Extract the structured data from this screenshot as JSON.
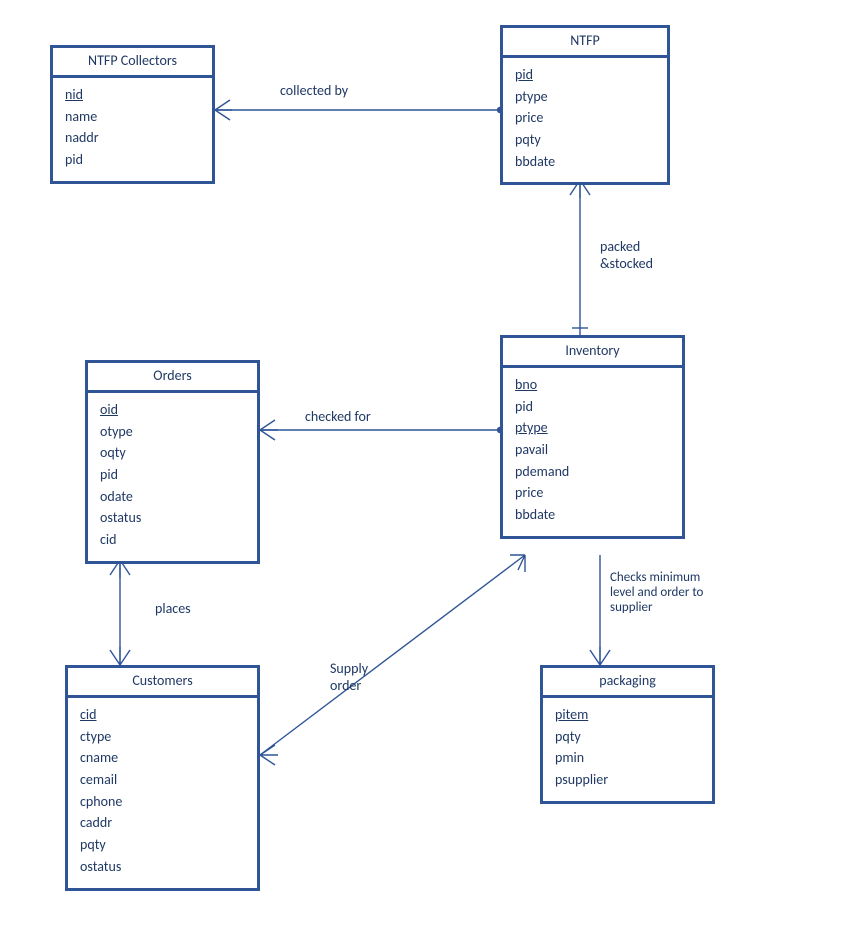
{
  "entities": {
    "collectors": {
      "title": "NTFP Collectors",
      "attrs": [
        "nid",
        "name",
        "naddr",
        "pid"
      ],
      "pk": [
        "nid"
      ]
    },
    "ntfp": {
      "title": "NTFP",
      "attrs": [
        "pid",
        "ptype",
        "price",
        "pqty",
        "bbdate"
      ],
      "pk": [
        "pid"
      ]
    },
    "orders": {
      "title": "Orders",
      "attrs": [
        "oid",
        "otype",
        "oqty",
        "pid",
        "odate",
        "ostatus",
        "cid"
      ],
      "pk": [
        "oid"
      ]
    },
    "inventory": {
      "title": "Inventory",
      "attrs": [
        "bno",
        "pid",
        "ptype",
        "pavail",
        "pdemand",
        "price",
        "bbdate"
      ],
      "pk": [
        "bno",
        "ptype"
      ]
    },
    "customers": {
      "title": "Customers",
      "attrs": [
        "cid",
        "ctype",
        "cname",
        "cemail",
        "cphone",
        "caddr",
        "pqty",
        "ostatus"
      ],
      "pk": [
        "cid"
      ]
    },
    "packaging": {
      "title": "packaging",
      "attrs": [
        "pitem",
        "pqty",
        "pmin",
        "psupplier"
      ],
      "pk": [
        "pitem"
      ]
    }
  },
  "relationships": {
    "collected_by": "collected by",
    "packed_stocked": "packed\n&stocked",
    "checked_for": "checked for",
    "places": "places",
    "supply_order": "Supply\norder",
    "checks_min": "Checks minimum\nlevel and order to\nsupplier"
  }
}
